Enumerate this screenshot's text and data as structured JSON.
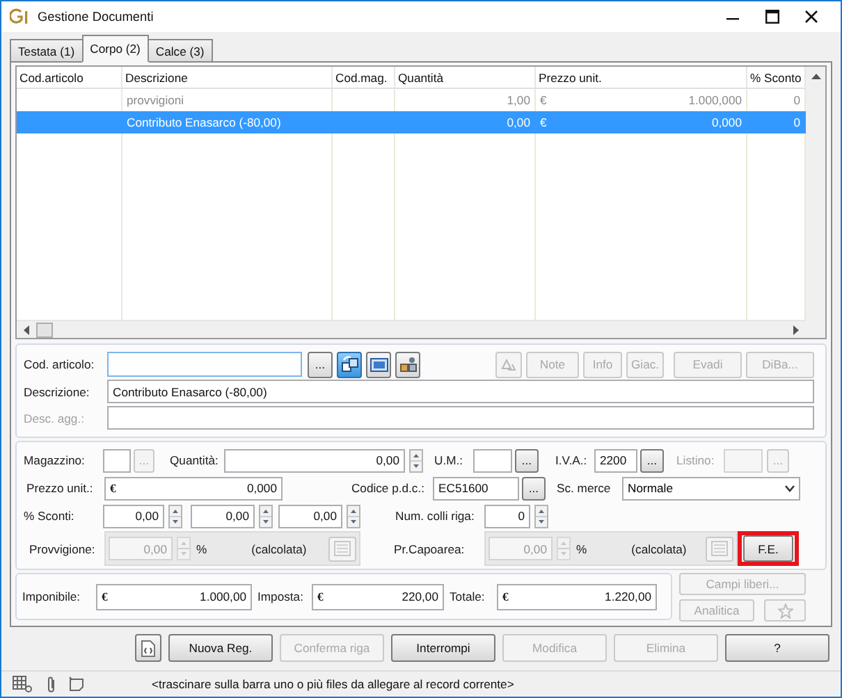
{
  "window": {
    "title": "Gestione Documenti"
  },
  "tabs": [
    {
      "label": "Testata (1)",
      "selected": false
    },
    {
      "label": "Corpo (2)",
      "selected": true
    },
    {
      "label": "Calce (3)",
      "selected": false
    }
  ],
  "table": {
    "columns": [
      "Cod.articolo",
      "Descrizione",
      "Cod.mag.",
      "Quantità",
      "Prezzo unit.",
      "% Sconto"
    ],
    "rows": [
      {
        "descrizione": "provvigioni",
        "quantita": "1,00",
        "currency": "€",
        "prezzo": "1.000,000",
        "sconto": "0",
        "selected": false,
        "dimmed": true
      },
      {
        "descrizione": "Contributo Enasarco (-80,00)",
        "quantita": "0,00",
        "currency": "€",
        "prezzo": "0,000",
        "sconto": "0",
        "selected": true,
        "dimmed": false
      }
    ]
  },
  "articolo": {
    "cod": {
      "label": "Cod. articolo:",
      "lookup": "..."
    },
    "tools": [
      {
        "kind": "cubes",
        "pressed": true
      },
      {
        "kind": "card",
        "pressed": false
      },
      {
        "kind": "boxes",
        "pressed": false
      }
    ],
    "actions": [
      {
        "kind": "icon",
        "disabled": true
      },
      {
        "kind": "text",
        "label": "Note",
        "disabled": true
      },
      {
        "kind": "text",
        "label": "Info",
        "disabled": true
      },
      {
        "kind": "text",
        "label": "Giac.",
        "disabled": true
      },
      {
        "kind": "text",
        "label": "Evadi",
        "disabled": true
      },
      {
        "kind": "text",
        "label": "DiBa...",
        "disabled": true
      }
    ],
    "descrizione": {
      "label": "Descrizione:",
      "value": "Contributo Enasarco (-80,00)"
    },
    "desc_agg": {
      "label": "Desc. agg.:",
      "disabled": true
    }
  },
  "dettaglio": {
    "magazzino": {
      "label": "Magazzino:",
      "lookup": {
        "text": "...",
        "disabled": true
      }
    },
    "quantita": {
      "label": "Quantità:",
      "value": "0,00"
    },
    "um": {
      "label": "U.M.:",
      "lookup": {
        "text": "...",
        "disabled": false
      }
    },
    "iva": {
      "label": "I.V.A.:",
      "value": "2200",
      "lookup": {
        "text": "...",
        "disabled": false
      }
    },
    "listino": {
      "label": "Listino:",
      "disabled": true,
      "lookup": {
        "text": "...",
        "disabled": true
      }
    },
    "prezzo": {
      "label": "Prezzo unit.:",
      "currency": "€",
      "value": "0,000"
    },
    "codice_pdc": {
      "label": "Codice p.d.c.:",
      "value": "EC51600",
      "lookup": {
        "text": "...",
        "disabled": false
      }
    },
    "sc_merce": {
      "label": "Sc. merce",
      "value": "Normale"
    },
    "sconti": {
      "label": "% Sconti:",
      "values": [
        "0,00",
        "0,00",
        "0,00"
      ]
    },
    "colli": {
      "label": "Num. colli riga:",
      "value": "0"
    },
    "provvigione": {
      "label": "Provvigione:",
      "value": "0,00",
      "unit": "%",
      "note": "(calcolata)",
      "disabled": true
    },
    "capoarea": {
      "label": "Pr.Capoarea:",
      "value": "0,00",
      "unit": "%",
      "note": "(calcolata)",
      "disabled": true
    },
    "fe_button": {
      "label": "F.E.",
      "highlighted": true
    }
  },
  "totali": {
    "fields": [
      {
        "label": "Imponibile:",
        "currency": "€",
        "value": "1.000,00"
      },
      {
        "label": "Imposta:",
        "currency": "€",
        "value": "220,00"
      },
      {
        "label": "Totale:",
        "currency": "€",
        "value": "1.220,00"
      }
    ],
    "campi_liberi": {
      "label": "Campi liberi...",
      "disabled": true
    },
    "analitica": {
      "label": "Analitica",
      "disabled": true
    },
    "extra": {
      "disabled": true
    }
  },
  "actions": [
    {
      "kind": "icon",
      "disabled": false
    },
    {
      "kind": "text",
      "label": "Nuova Reg.",
      "disabled": false
    },
    {
      "kind": "text",
      "label": "Conferma riga",
      "disabled": true
    },
    {
      "kind": "text",
      "label": "Interrompi",
      "disabled": false
    },
    {
      "kind": "text",
      "label": "Modifica",
      "disabled": true
    },
    {
      "kind": "text",
      "label": "Elimina",
      "disabled": true
    },
    {
      "kind": "text",
      "label": "?",
      "disabled": false
    }
  ],
  "status_bar": {
    "text": "<trascinare sulla barra uno o più files da allegare al record corrente>"
  }
}
